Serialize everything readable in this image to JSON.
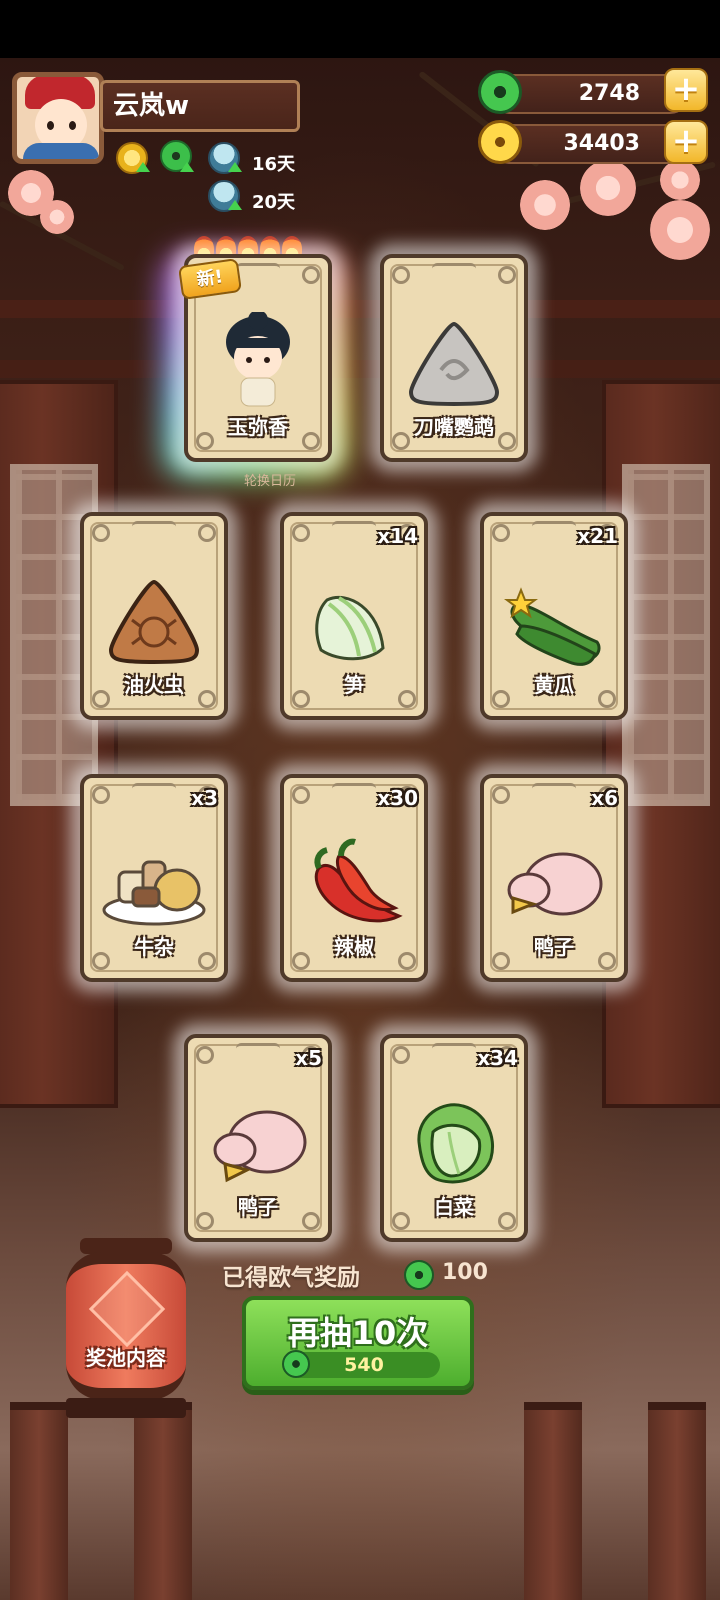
{
  "player": {
    "name": "云岚w"
  },
  "buffs": [
    {
      "icon": "coin-buff-icon"
    },
    {
      "icon": "jade-buff-icon"
    },
    {
      "icon": "bowl-buff-icon",
      "days": "16天"
    },
    {
      "icon": "bowl-buff-icon",
      "days": "20天"
    }
  ],
  "resources": {
    "jade": {
      "value": "2748",
      "icon": "jade-icon"
    },
    "coins": {
      "value": "34403",
      "icon": "coin-icon"
    },
    "plus_label": "+"
  },
  "cards": [
    {
      "label": "玉弥香",
      "count": "",
      "new": true,
      "new_label": "新!",
      "flames": 5,
      "art": "character"
    },
    {
      "label": "刀嘴鹦鹉",
      "count": "",
      "art": "locked-triangle"
    },
    {
      "label": "油火虫",
      "count": "",
      "art": "bug-triangle"
    },
    {
      "label": "笋",
      "count": "x14",
      "art": "bamboo-shoot"
    },
    {
      "label": "黄瓜",
      "count": "x21",
      "art": "cucumber"
    },
    {
      "label": "牛杂",
      "count": "x3",
      "art": "beef-offal"
    },
    {
      "label": "辣椒",
      "count": "x30",
      "art": "chili"
    },
    {
      "label": "鸭子",
      "count": "x6",
      "art": "duck"
    },
    {
      "label": "鸭子",
      "count": "x5",
      "art": "duck"
    },
    {
      "label": "白菜",
      "count": "x34",
      "art": "cabbage"
    }
  ],
  "calendar_label": "轮换日历",
  "bonus": {
    "label": "已得欧气奖励",
    "value": "100"
  },
  "pool_button": {
    "label": "奖池内容"
  },
  "draw_button": {
    "label": "再抽10次",
    "cost": "540"
  },
  "colors": {
    "accent_green": "#4dae2e",
    "card_bg": "#eddbb3",
    "wood": "#5b2f22"
  }
}
